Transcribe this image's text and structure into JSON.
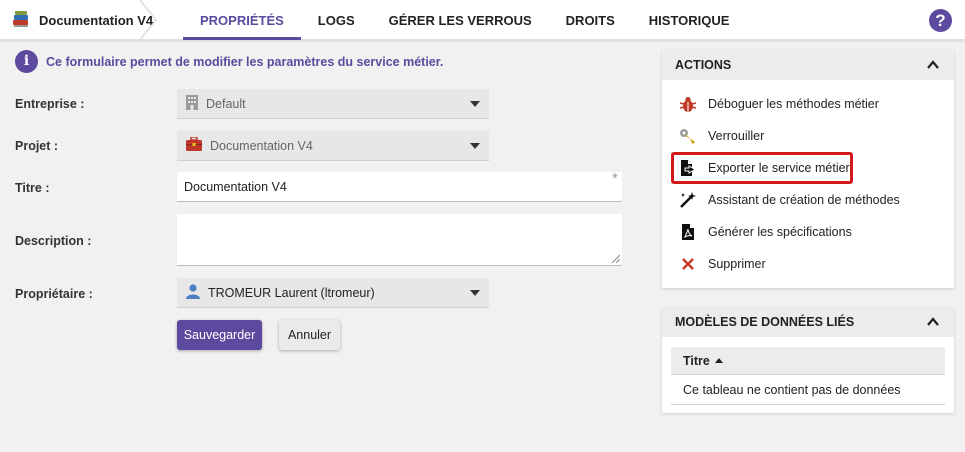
{
  "header": {
    "breadcrumb_label": "Documentation V4",
    "tabs": [
      {
        "label": "PROPRIÉTÉS",
        "active": true
      },
      {
        "label": "LOGS",
        "active": false
      },
      {
        "label": "GÉRER LES VERROUS",
        "active": false
      },
      {
        "label": "DROITS",
        "active": false
      },
      {
        "label": "HISTORIQUE",
        "active": false
      }
    ],
    "help_icon": "question-circle-icon",
    "accent_color": "#5b4a9e"
  },
  "info": {
    "text": "Ce formulaire permet de modifier les paramètres du service métier."
  },
  "form": {
    "entreprise": {
      "label": "Entreprise :",
      "value": "Default",
      "icon": "building-icon"
    },
    "projet": {
      "label": "Projet :",
      "value": "Documentation V4",
      "icon": "briefcase-icon"
    },
    "titre": {
      "label": "Titre :",
      "value": "Documentation V4",
      "required_mark": "*"
    },
    "description": {
      "label": "Description :",
      "value": ""
    },
    "proprietaire": {
      "label": "Propriétaire :",
      "value": "TROMEUR Laurent (ltromeur)",
      "icon": "user-icon"
    },
    "save_label": "Sauvegarder",
    "cancel_label": "Annuler"
  },
  "actions_panel": {
    "title": "ACTIONS",
    "items": [
      {
        "label": "Déboguer les méthodes métier",
        "icon": "bug-icon"
      },
      {
        "label": "Verrouiller",
        "icon": "key-icon"
      },
      {
        "label": "Exporter le service métier",
        "icon": "file-export-icon",
        "highlighted": true
      },
      {
        "label": "Assistant de création de méthodes",
        "icon": "magic-wand-icon"
      },
      {
        "label": "Générer les spécifications",
        "icon": "file-pdf-icon"
      },
      {
        "label": "Supprimer",
        "icon": "delete-x-icon"
      }
    ],
    "highlight_color": "#d11a1a"
  },
  "models_panel": {
    "title": "MODÈLES DE DONNÉES LIÉS",
    "column_header": "Titre",
    "empty_text": "Ce tableau ne contient pas de données"
  }
}
